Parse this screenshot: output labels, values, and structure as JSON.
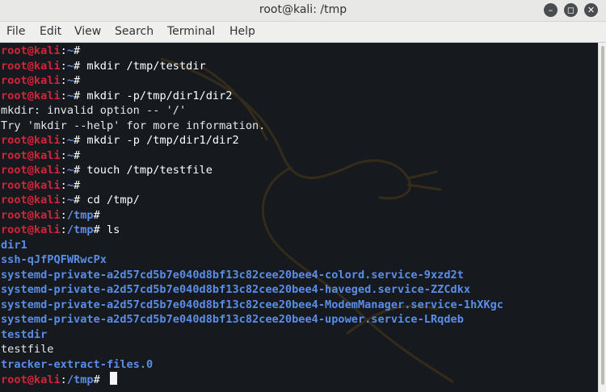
{
  "window": {
    "title": "root@kali: /tmp"
  },
  "menu": [
    "File",
    "Edit",
    "View",
    "Search",
    "Terminal",
    "Help"
  ],
  "window_buttons": {
    "minimize": "–",
    "maximize": "◻",
    "close": "✕"
  },
  "prompt": {
    "user": "root@kali",
    "sep": ":",
    "suffix": "#"
  },
  "terminal": {
    "lines": [
      {
        "type": "prompt",
        "path": "~",
        "cmd": ""
      },
      {
        "type": "prompt",
        "path": "~",
        "cmd": " mkdir /tmp/testdir"
      },
      {
        "type": "prompt",
        "path": "~",
        "cmd": ""
      },
      {
        "type": "prompt",
        "path": "~",
        "cmd": " mkdir -p/tmp/dir1/dir2"
      },
      {
        "type": "output",
        "text": "mkdir: invalid option -- '/'"
      },
      {
        "type": "output",
        "text": "Try 'mkdir --help' for more information."
      },
      {
        "type": "prompt",
        "path": "~",
        "cmd": " mkdir -p /tmp/dir1/dir2"
      },
      {
        "type": "prompt",
        "path": "~",
        "cmd": ""
      },
      {
        "type": "prompt",
        "path": "~",
        "cmd": " touch /tmp/testfile"
      },
      {
        "type": "prompt",
        "path": "~",
        "cmd": ""
      },
      {
        "type": "prompt",
        "path": "~",
        "cmd": " cd /tmp/"
      },
      {
        "type": "prompt",
        "path": "/tmp",
        "cmd": ""
      },
      {
        "type": "prompt",
        "path": "/tmp",
        "cmd": " ls"
      },
      {
        "type": "dir",
        "text": "dir1"
      },
      {
        "type": "dir",
        "text": "ssh-qJfPQFWRwcPx"
      },
      {
        "type": "dir",
        "text": "systemd-private-a2d57cd5b7e040d8bf13c82cee20bee4-colord.service-9xzd2t"
      },
      {
        "type": "dir",
        "text": "systemd-private-a2d57cd5b7e040d8bf13c82cee20bee4-haveged.service-ZZCdkx"
      },
      {
        "type": "dir",
        "text": "systemd-private-a2d57cd5b7e040d8bf13c82cee20bee4-ModemManager.service-1hXKgc"
      },
      {
        "type": "dir",
        "text": "systemd-private-a2d57cd5b7e040d8bf13c82cee20bee4-upower.service-LRqdeb"
      },
      {
        "type": "dir",
        "text": "testdir"
      },
      {
        "type": "file",
        "text": "testfile"
      },
      {
        "type": "dir",
        "text": "tracker-extract-files.0"
      },
      {
        "type": "prompt",
        "path": "/tmp",
        "cmd": " ",
        "cursor": true
      }
    ]
  },
  "colors": {
    "user": "#d4233a",
    "path": "#5b8de8",
    "background": "#161a1f",
    "dir": "#5b8de8"
  },
  "icons": {
    "background_logo": "kali-dragon-icon"
  }
}
